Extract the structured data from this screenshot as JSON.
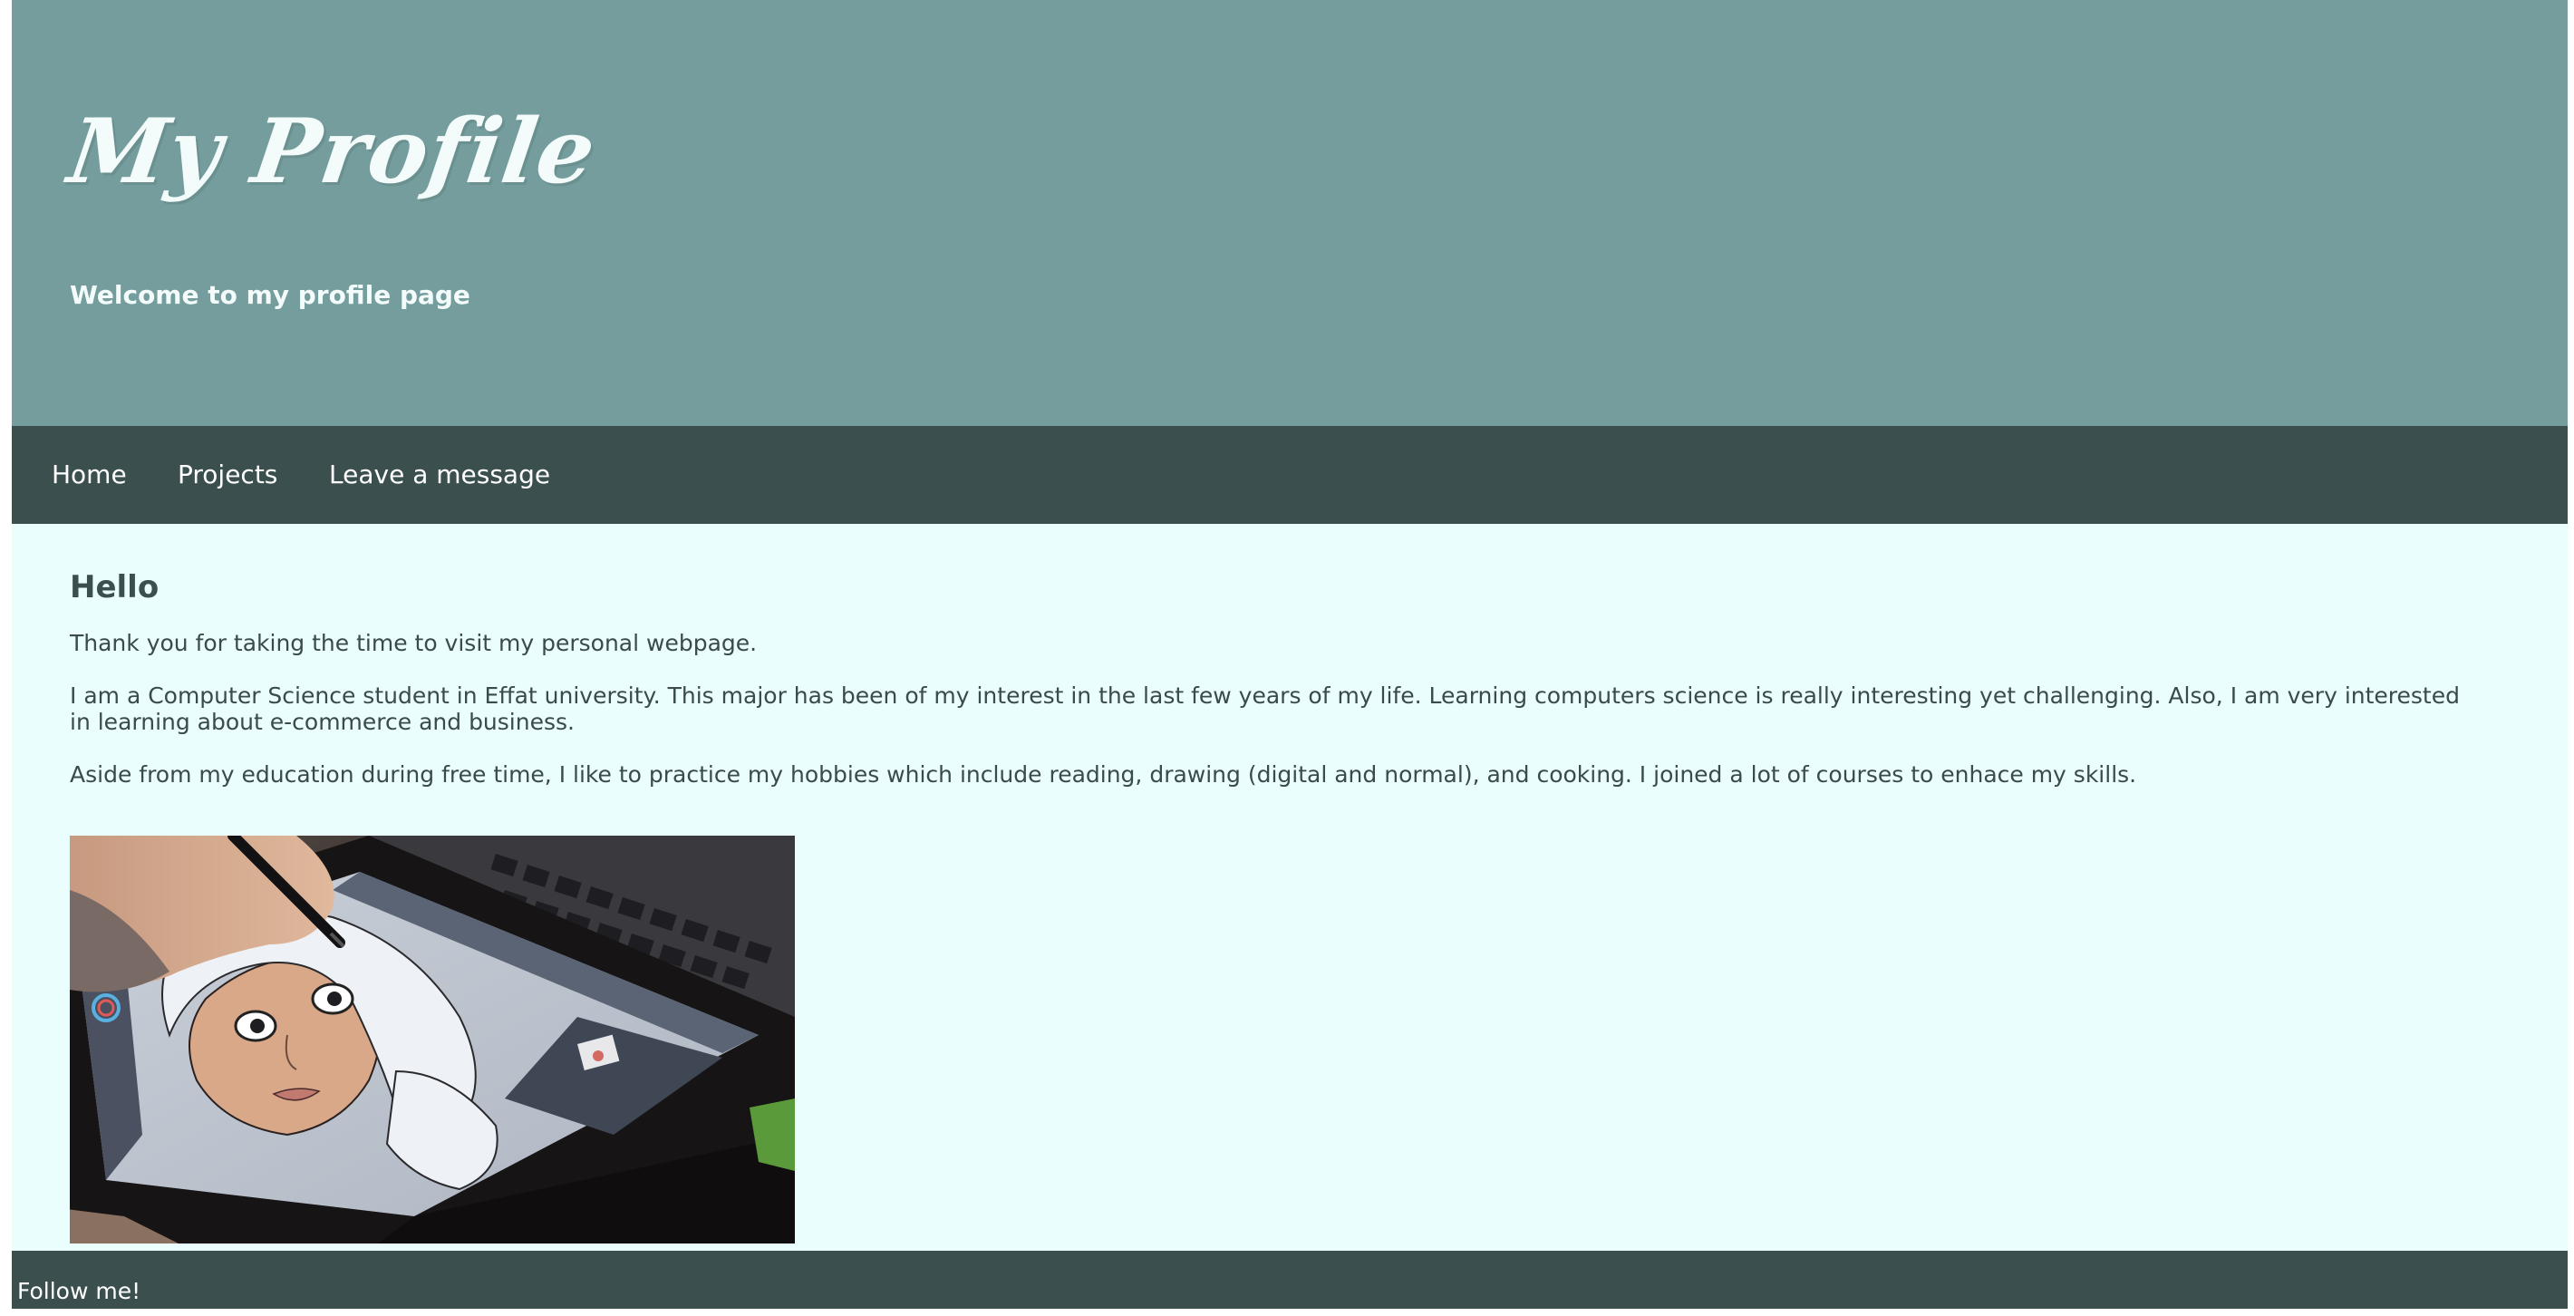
{
  "header": {
    "title": "My Profile",
    "subtitle": "Welcome to my profile page"
  },
  "nav": {
    "home": "Home",
    "projects": "Projects",
    "message": "Leave a message"
  },
  "main": {
    "heading": "Hello",
    "paragraphs": [
      "Thank you for taking the time to visit my personal webpage.",
      "I am a Computer Science student in Effat university. This major has been of my interest in the last few years of my life. Learning computers science is really interesting yet challenging. Also, I am very interested in learning about e-commerce and business.",
      "Aside from my education during free time, I like to practice my hobbies which include reading, drawing (digital and normal), and cooking. I joined a lot of courses to enhace my skills."
    ]
  },
  "footer": {
    "text": "Follow me!"
  },
  "colors": {
    "header_bg": "#759d9d",
    "nav_bg": "#3b4f4f",
    "page_bg": "#eafefe",
    "text": "#3b4a4a"
  }
}
